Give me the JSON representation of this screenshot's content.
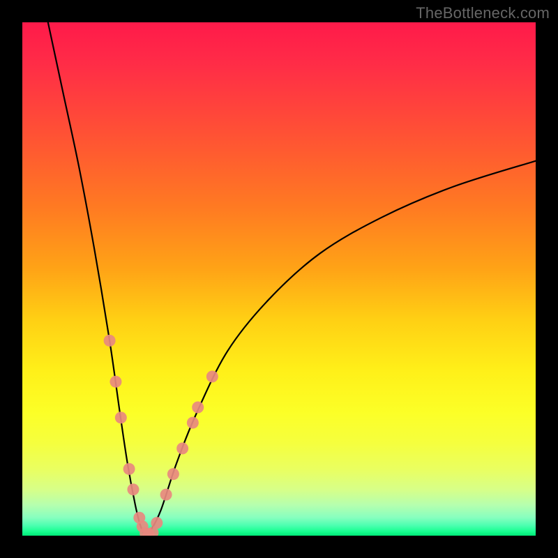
{
  "watermark": "TheBottleneck.com",
  "chart_data": {
    "type": "line",
    "title": "",
    "xlabel": "",
    "ylabel": "",
    "xlim": [
      0,
      100
    ],
    "ylim": [
      0,
      100
    ],
    "series": [
      {
        "name": "bottleneck-curve",
        "x": [
          5,
          8,
          11,
          14,
          17,
          19,
          20.5,
          22,
          23,
          24,
          25,
          27,
          30,
          34,
          40,
          48,
          58,
          70,
          84,
          100
        ],
        "y": [
          100,
          86,
          72,
          56,
          38,
          24,
          14,
          6,
          2,
          0,
          1,
          5,
          14,
          24,
          36,
          46,
          55,
          62,
          68,
          73
        ]
      }
    ],
    "markers": {
      "name": "data-points",
      "color": "#e8897f",
      "points": [
        {
          "x": 17.0,
          "y": 38
        },
        {
          "x": 18.2,
          "y": 30
        },
        {
          "x": 19.2,
          "y": 23
        },
        {
          "x": 20.8,
          "y": 13
        },
        {
          "x": 21.6,
          "y": 9
        },
        {
          "x": 22.8,
          "y": 3.5
        },
        {
          "x": 23.4,
          "y": 1.8
        },
        {
          "x": 24.0,
          "y": 0.5
        },
        {
          "x": 24.6,
          "y": 0.3
        },
        {
          "x": 25.4,
          "y": 0.6
        },
        {
          "x": 26.2,
          "y": 2.5
        },
        {
          "x": 28.0,
          "y": 8
        },
        {
          "x": 29.4,
          "y": 12
        },
        {
          "x": 31.2,
          "y": 17
        },
        {
          "x": 33.2,
          "y": 22
        },
        {
          "x": 34.2,
          "y": 25
        },
        {
          "x": 37.0,
          "y": 31
        }
      ]
    },
    "gradient_stops": [
      {
        "pos": 0,
        "color": "#ff1a4a"
      },
      {
        "pos": 50,
        "color": "#ffbf15"
      },
      {
        "pos": 80,
        "color": "#fbff2a"
      },
      {
        "pos": 100,
        "color": "#00e878"
      }
    ]
  }
}
